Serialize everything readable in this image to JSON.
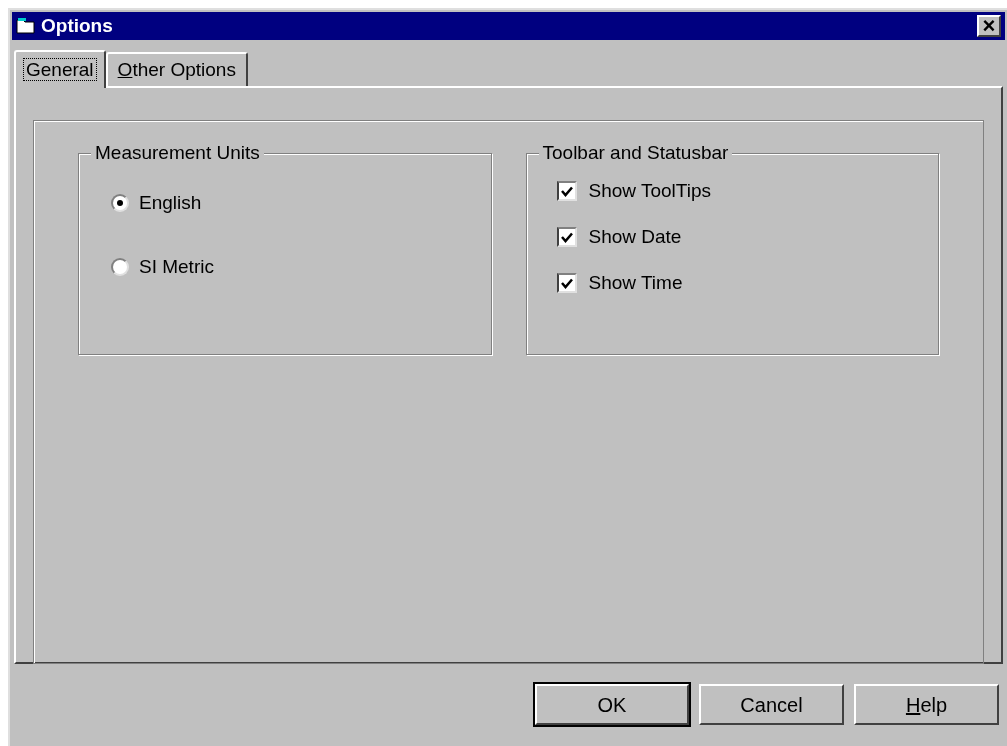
{
  "window": {
    "title": "Options",
    "close": "×"
  },
  "tabs": [
    {
      "label": "General",
      "selected": true,
      "underline_first": false
    },
    {
      "label": "Other Options",
      "selected": false,
      "underline_first": true
    }
  ],
  "measurement_units": {
    "title": "Measurement Units",
    "options": [
      {
        "label": "English",
        "selected": true
      },
      {
        "label": "SI Metric",
        "selected": false
      }
    ]
  },
  "toolbar_and_statusbar": {
    "title": "Toolbar and Statusbar",
    "options": [
      {
        "label": "Show ToolTips",
        "checked": true
      },
      {
        "label": "Show Date",
        "checked": true
      },
      {
        "label": "Show Time",
        "checked": true
      }
    ]
  },
  "buttons": [
    {
      "label": "OK",
      "default": true,
      "underline_first": false
    },
    {
      "label": "Cancel",
      "default": false,
      "underline_first": false
    },
    {
      "label": "Help",
      "default": false,
      "underline_first": true
    }
  ]
}
